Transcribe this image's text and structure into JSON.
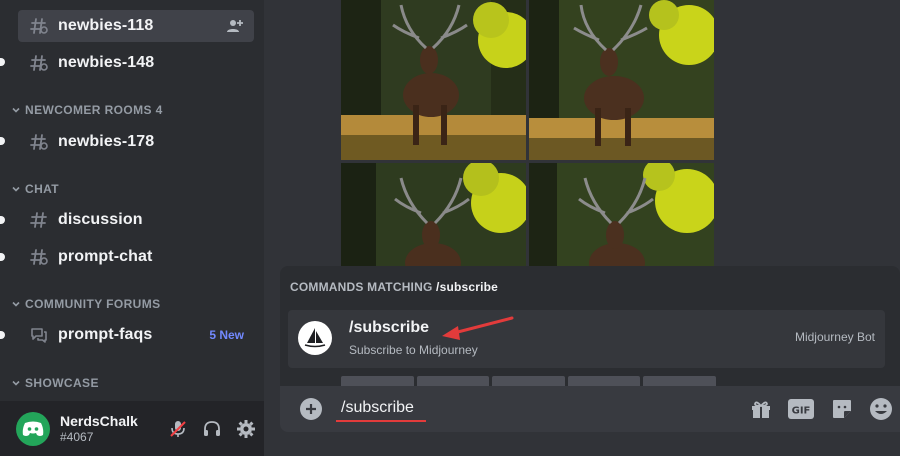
{
  "sidebar": {
    "channels": [
      {
        "label": "newbies-118"
      },
      {
        "label": "newbies-148"
      },
      {
        "label": "newbies-178"
      },
      {
        "label": "discussion"
      },
      {
        "label": "prompt-chat"
      },
      {
        "label": "prompt-faqs",
        "badge": "5 New"
      }
    ],
    "categories": [
      {
        "label": "NEWCOMER ROOMS 4"
      },
      {
        "label": "CHAT"
      },
      {
        "label": "COMMUNITY FORUMS"
      },
      {
        "label": "SHOWCASE"
      }
    ]
  },
  "user": {
    "name": "NerdsChalk",
    "tag": "#4067"
  },
  "commands": {
    "header_prefix": "COMMANDS MATCHING ",
    "header_query": "/subscribe",
    "items": [
      {
        "name": "/subscribe",
        "description": "Subscribe to Midjourney",
        "bot": "Midjourney Bot"
      }
    ]
  },
  "input": {
    "value": "/subscribe"
  },
  "icons": {
    "gift": "gift-icon",
    "gif": "gif-icon",
    "sticker": "sticker-icon",
    "emoji": "emoji-icon"
  },
  "colors": {
    "accent": "#5865f2",
    "online": "#23a55a",
    "annotation": "#e23b3b",
    "new_badge": "#7289ff"
  }
}
